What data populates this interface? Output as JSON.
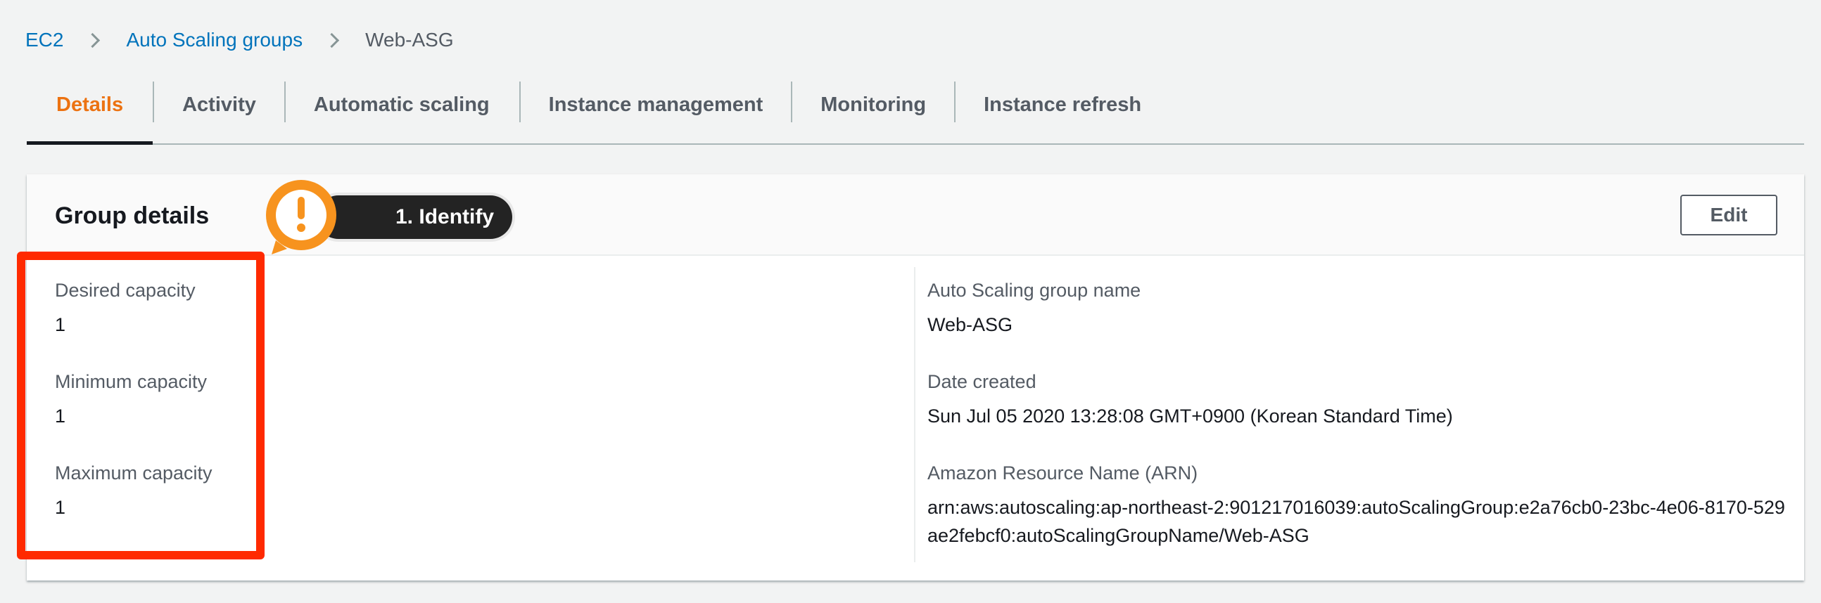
{
  "breadcrumb": {
    "items": [
      "EC2",
      "Auto Scaling groups"
    ],
    "current": "Web-ASG"
  },
  "tabs": [
    {
      "label": "Details",
      "active": true
    },
    {
      "label": "Activity"
    },
    {
      "label": "Automatic scaling"
    },
    {
      "label": "Instance management"
    },
    {
      "label": "Monitoring"
    },
    {
      "label": "Instance refresh"
    }
  ],
  "panel": {
    "title": "Group details",
    "edit_label": "Edit",
    "left": [
      {
        "label": "Desired capacity",
        "value": "1"
      },
      {
        "label": "Minimum capacity",
        "value": "1"
      },
      {
        "label": "Maximum capacity",
        "value": "1"
      }
    ],
    "right": [
      {
        "label": "Auto Scaling group name",
        "value": "Web-ASG"
      },
      {
        "label": "Date created",
        "value": "Sun Jul 05 2020 13:28:08 GMT+0900 (Korean Standard Time)"
      },
      {
        "label": "Amazon Resource Name (ARN)",
        "value": "arn:aws:autoscaling:ap-northeast-2:901217016039:autoScalingGroup:e2a76cb0-23bc-4e06-8170-529ae2febcf0:autoScalingGroupName/Web-ASG"
      }
    ]
  },
  "callout": {
    "label": "1. Identify",
    "icon": "exclamation-icon",
    "color": "#f7931e"
  },
  "colors": {
    "link": "#0073bb",
    "active_tab": "#ec7211",
    "highlight": "#ff2a00"
  }
}
